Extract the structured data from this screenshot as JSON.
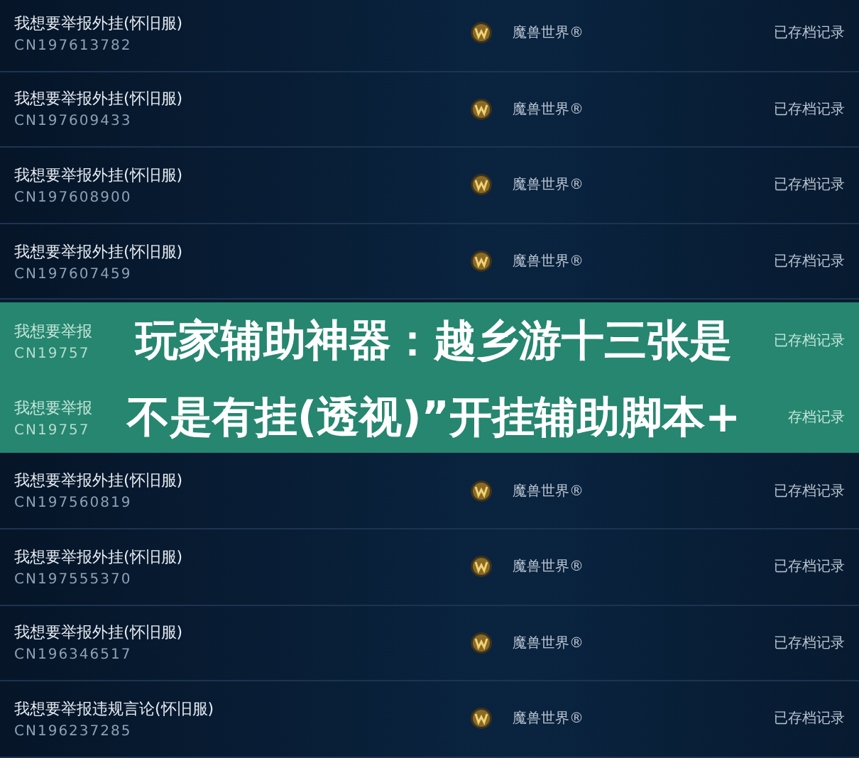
{
  "reports": [
    {
      "title": "我想要举报外挂(怀旧服)",
      "ticket": "CN197613782",
      "game": "魔兽世界®",
      "status": "已存档记录"
    },
    {
      "title": "我想要举报外挂(怀旧服)",
      "ticket": "CN197609433",
      "game": "魔兽世界®",
      "status": "已存档记录"
    },
    {
      "title": "我想要举报外挂(怀旧服)",
      "ticket": "CN197608900",
      "game": "魔兽世界®",
      "status": "已存档记录"
    },
    {
      "title": "我想要举报外挂(怀旧服)",
      "ticket": "CN197607459",
      "game": "魔兽世界®",
      "status": "已存档记录"
    },
    {
      "title": "我想要举报外挂(怀旧服)",
      "ticket": "CN197560819",
      "game": "魔兽世界®",
      "status": "已存档记录"
    },
    {
      "title": "我想要举报外挂(怀旧服)",
      "ticket": "CN197555370",
      "game": "魔兽世界®",
      "status": "已存档记录"
    },
    {
      "title": "我想要举报外挂(怀旧服)",
      "ticket": "CN196346517",
      "game": "魔兽世界®",
      "status": "已存档记录"
    },
    {
      "title": "我想要举报违规言论(怀旧服)",
      "ticket": "CN196237285",
      "game": "魔兽世界®",
      "status": "已存档记录"
    }
  ],
  "overlay": {
    "rows": [
      {
        "title": "我想要举报",
        "ticket": "CN19757",
        "status": "已存档记录",
        "line": "玩家辅助神器：越乡游十三张是"
      },
      {
        "title": "我想要举报",
        "ticket": "CN19757",
        "status": "存档记录",
        "line": "不是有挂(透视)”开挂辅助脚本+"
      }
    ]
  }
}
